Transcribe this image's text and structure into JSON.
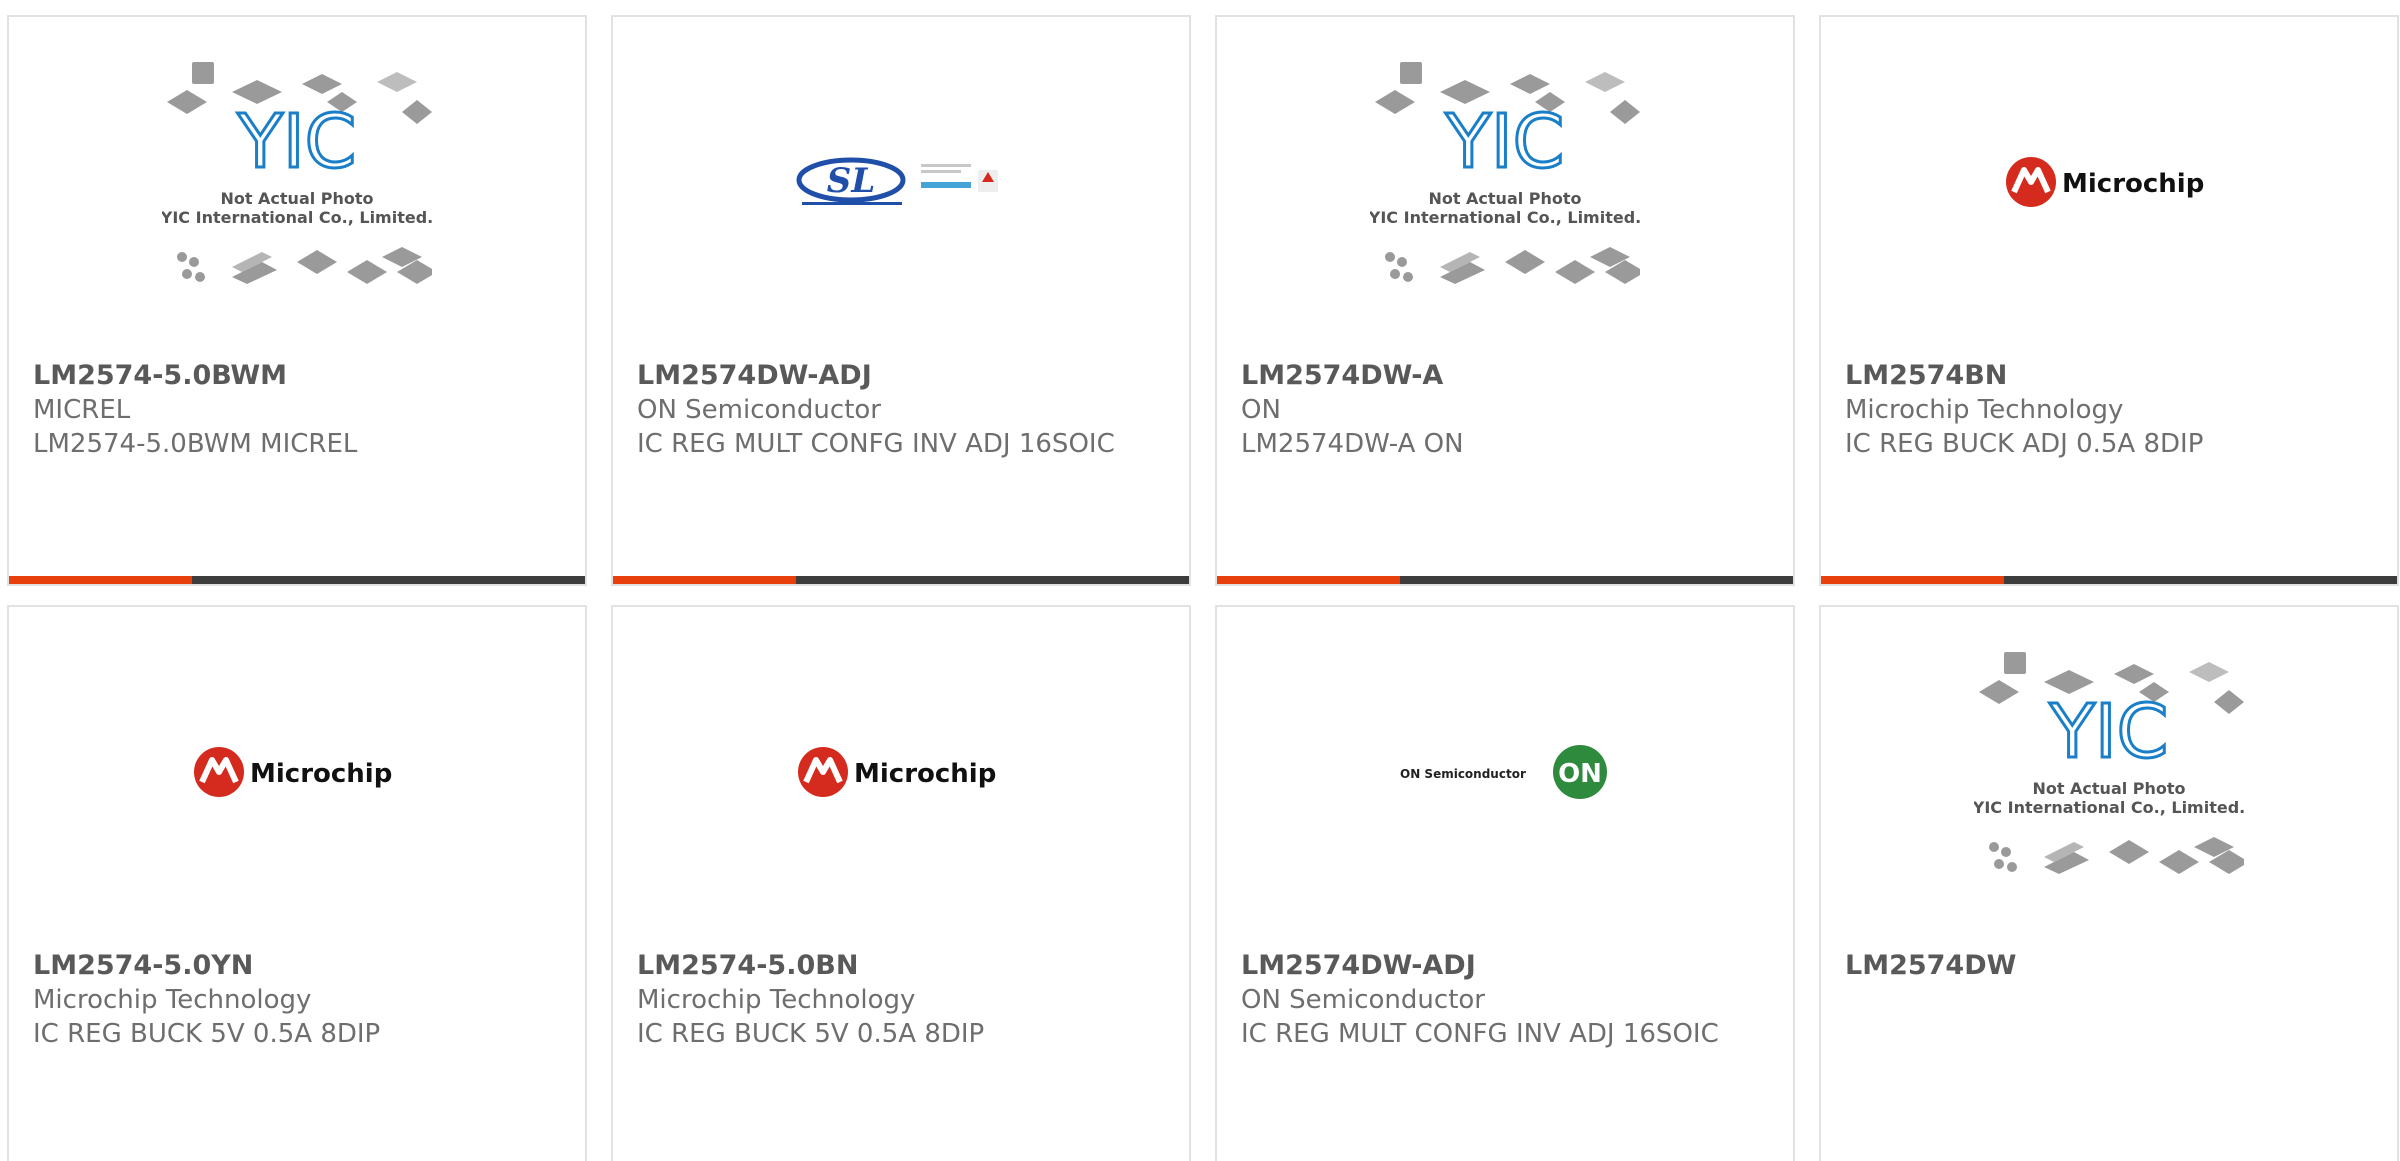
{
  "placeholder": {
    "caption_line1": "Not Actual Photo",
    "caption_line2": "YIC International Co., Limited.",
    "logo_text": "YIC"
  },
  "brands": {
    "microchip": "Microchip",
    "on_semi": "ON Semiconductor",
    "on_badge": "ON",
    "sl": "SL"
  },
  "products": [
    {
      "part": "LM2574-5.0BWM",
      "manufacturer": "MICREL",
      "description": "LM2574-5.0BWM MICREL",
      "image": "placeholder"
    },
    {
      "part": "LM2574DW-ADJ",
      "manufacturer": "ON Semiconductor",
      "description": "IC REG MULT CONFG INV ADJ 16SOIC",
      "image": "sl-logo"
    },
    {
      "part": "LM2574DW-A",
      "manufacturer": "ON",
      "description": "LM2574DW-A ON",
      "image": "placeholder"
    },
    {
      "part": "LM2574BN",
      "manufacturer": "Microchip Technology",
      "description": "IC REG BUCK ADJ 0.5A 8DIP",
      "image": "microchip-logo"
    },
    {
      "part": "LM2574-5.0YN",
      "manufacturer": "Microchip Technology",
      "description": "IC REG BUCK 5V 0.5A 8DIP",
      "image": "microchip-logo"
    },
    {
      "part": "LM2574-5.0BN",
      "manufacturer": "Microchip Technology",
      "description": "IC REG BUCK 5V 0.5A 8DIP",
      "image": "microchip-logo"
    },
    {
      "part": "LM2574DW-ADJ",
      "manufacturer": "ON Semiconductor",
      "description": "IC REG MULT CONFG INV ADJ 16SOIC",
      "image": "on-semi-logo"
    },
    {
      "part": "LM2574DW",
      "manufacturer": "",
      "description": "",
      "image": "placeholder"
    }
  ],
  "colors": {
    "accent": "#e8400c",
    "bar": "#3d3d3d",
    "microchip_red": "#d52b1e",
    "on_green": "#2e8b3e",
    "sl_blue": "#1f4fa8"
  }
}
